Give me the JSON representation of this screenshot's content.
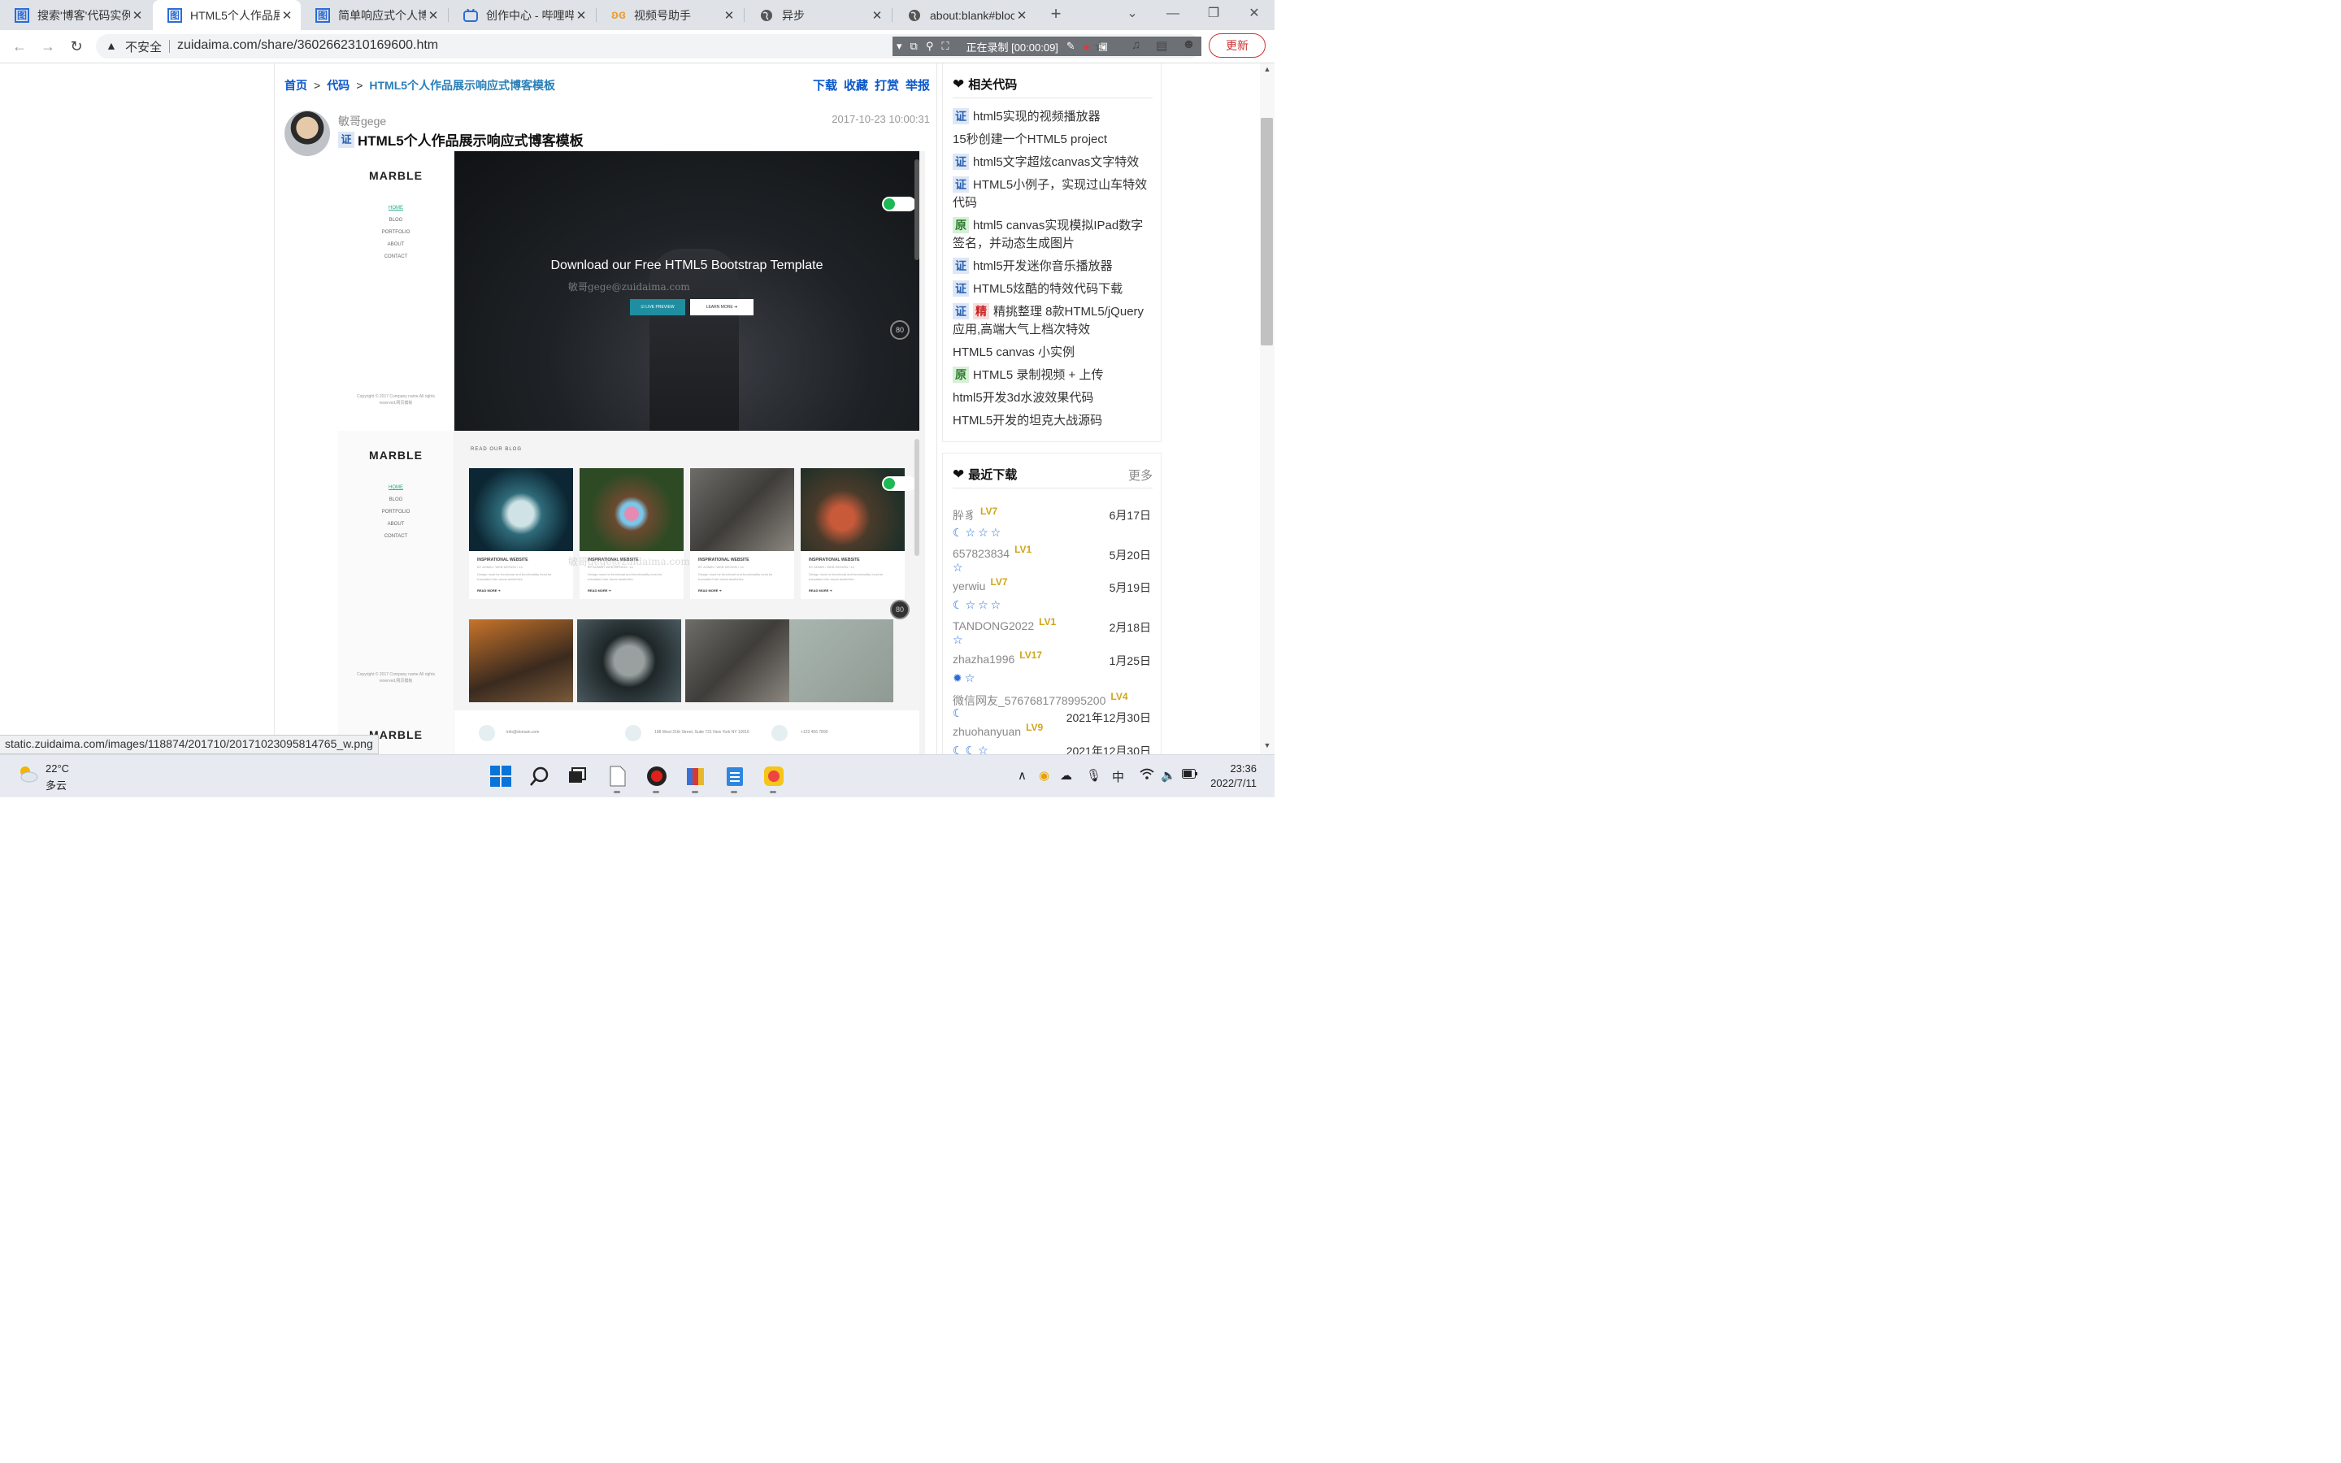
{
  "tabs": [
    {
      "label": "搜索'博客'代码实例",
      "active": false
    },
    {
      "label": "HTML5个人作品展",
      "active": true
    },
    {
      "label": "简单响应式个人博客",
      "active": false
    },
    {
      "label": "创作中心 - 哔哩哔哩",
      "active": false
    },
    {
      "label": "视频号助手",
      "active": false
    },
    {
      "label": "异步",
      "active": false
    },
    {
      "label": "about:blank#bloc",
      "active": false
    }
  ],
  "addressbar": {
    "security": "不安全",
    "url": "zuidaima.com/share/3602662310169600.htm",
    "recording": "正在录制 [00:00:09]",
    "update": "更新"
  },
  "breadcrumb": {
    "home": "首页",
    "code": "代码",
    "current": "HTML5个人作品展示响应式博客模板",
    "sep": ">"
  },
  "actions": [
    "下载",
    "收藏",
    "打赏",
    "举报"
  ],
  "post": {
    "author": "敏哥gege",
    "date": "2017-10-23 10:00:31",
    "badge": "证",
    "title": "HTML5个人作品展示响应式博客模板"
  },
  "preview": {
    "logo": "MARBLE",
    "menu": [
      "HOME",
      "BLOG",
      "PORTFOLIO",
      "ABOUT",
      "CONTACT"
    ],
    "copyright": "Copyright © 2017 Company name All rights reserved.网页模板",
    "hero_title": "Download our Free HTML5 Bootstrap Template",
    "live_preview": "☑ LIVE PREVIEW",
    "learn_more": "LEARN MORE ➔",
    "watermark": "敏哥gege@zuidaima.com",
    "blog_heading": "READ OUR BLOG",
    "card_title": "INSPIRATIONAL WEBSITE",
    "card_meta": "BY ADMIN / WEB DESIGN / 14",
    "card_text": "Design must be functional and functionality must be translated into visual aesthetics",
    "read_more": "READ MORE ➔",
    "contact_email": "info@domain.com",
    "contact_address": "198 West 21th Street, Suite 721 New York NY 10016",
    "contact_phone": "+123 456 7890",
    "badge_label": "80"
  },
  "related": {
    "heading": "相关代码",
    "items": [
      {
        "badges": [
          "证"
        ],
        "text": "html5实现的视频播放器"
      },
      {
        "badges": [],
        "text": "15秒创建一个HTML5 project"
      },
      {
        "badges": [
          "证"
        ],
        "text": "html5文字超炫canvas文字特效"
      },
      {
        "badges": [
          "证"
        ],
        "text": "HTML5小例子，实现过山车特效代码"
      },
      {
        "badges": [
          "原"
        ],
        "text": "html5 canvas实现模拟IPad数字签名，并动态生成图片"
      },
      {
        "badges": [
          "证"
        ],
        "text": "html5开发迷你音乐播放器"
      },
      {
        "badges": [
          "证"
        ],
        "text": "HTML5炫酷的特效代码下载"
      },
      {
        "badges": [
          "证",
          "精"
        ],
        "text": "精挑整理 8款HTML5/jQuery应用,高端大气上档次特效"
      },
      {
        "badges": [],
        "text": "HTML5 canvas 小实例"
      },
      {
        "badges": [
          "原"
        ],
        "text": "HTML5 录制视频 + 上传"
      },
      {
        "badges": [],
        "text": "html5开发3d水波效果代码"
      },
      {
        "badges": [],
        "text": "HTML5开发的坦克大战源码"
      }
    ]
  },
  "downloads": {
    "heading": "最近下载",
    "more": "更多",
    "items": [
      {
        "name": "肸豸",
        "level": "LV7",
        "date": "6月17日",
        "stars": "☾☆☆☆"
      },
      {
        "name": "657823834",
        "level": "LV1",
        "date": "5月20日",
        "stars": "☆"
      },
      {
        "name": "yerwiu",
        "level": "LV7",
        "date": "5月19日",
        "stars": "☾☆☆☆"
      },
      {
        "name": "TANDONG2022",
        "level": "LV1",
        "date": "2月18日",
        "stars": "☆"
      },
      {
        "name": "zhazha1996",
        "level": "LV17",
        "date": "1月25日",
        "stars": "✹☆"
      },
      {
        "name": "微信网友_5767681778995200",
        "level": "LV4",
        "date": "2021年12月30日",
        "stars": "☾"
      },
      {
        "name": "zhuohanyuan",
        "level": "LV9",
        "date": "2021年12月30日",
        "stars": "☾☾☆"
      }
    ]
  },
  "status_url": "static.zuidaima.com/images/118874/201710/20171023095814765_w.png",
  "taskbar": {
    "temperature": "22°C",
    "condition": "多云",
    "time": "23:36",
    "date": "2022/7/11",
    "ime": "中"
  }
}
